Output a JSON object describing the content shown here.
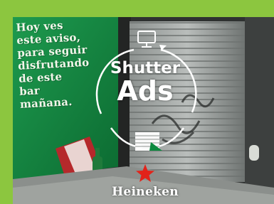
{
  "frame": {
    "border_color": "#8cc63f"
  },
  "wall_mural": {
    "lines": [
      "Hoy ves",
      "este aviso,",
      "para seguir",
      "disfrutando",
      "de este",
      "bar",
      "mañana."
    ],
    "color": "#14833f"
  },
  "badge": {
    "line1": "Shutter",
    "line2": "Ads",
    "icons": [
      "monitor-icon",
      "cycle-arrows",
      "shutter-icon"
    ]
  },
  "brand": {
    "name": "Heineken",
    "star_color": "#e2231a"
  }
}
